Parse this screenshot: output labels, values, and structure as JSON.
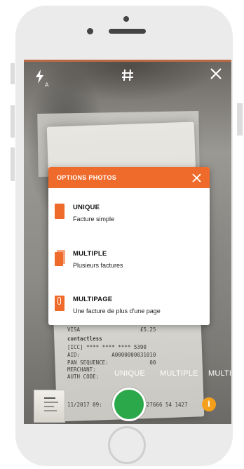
{
  "camera": {
    "flash_icon": "flash-auto-icon",
    "flash_label": "A",
    "grid_icon": "grid-icon",
    "close_icon": "close-icon"
  },
  "receipt": {
    "lines": [
      "VISA                   £5.25",
      "contactless",
      "[ICC] **** **** **** 5390",
      "AID:          A0000000031010",
      "PAN SEQUENCE:             00",
      "MERCHANT:",
      "AUTH CODE:",
      "11/2017 09:              27666 54 1427"
    ]
  },
  "modal": {
    "title": "OPTIONS PHOTOS",
    "close_label": "✕",
    "options": [
      {
        "label": "UNIQUE",
        "description": "Facture simple"
      },
      {
        "label": "MULTIPLE",
        "description": "Plusieurs factures"
      },
      {
        "label": "MULTIPAGE",
        "description": "Une facture de plus d'une page"
      }
    ]
  },
  "modes": [
    "UNIQUE",
    "MULTIPLE",
    "MULTI"
  ],
  "info_label": "i",
  "colors": {
    "accent": "#ef6b2b",
    "shutter": "#2ba84a",
    "info": "#f4a01c"
  }
}
